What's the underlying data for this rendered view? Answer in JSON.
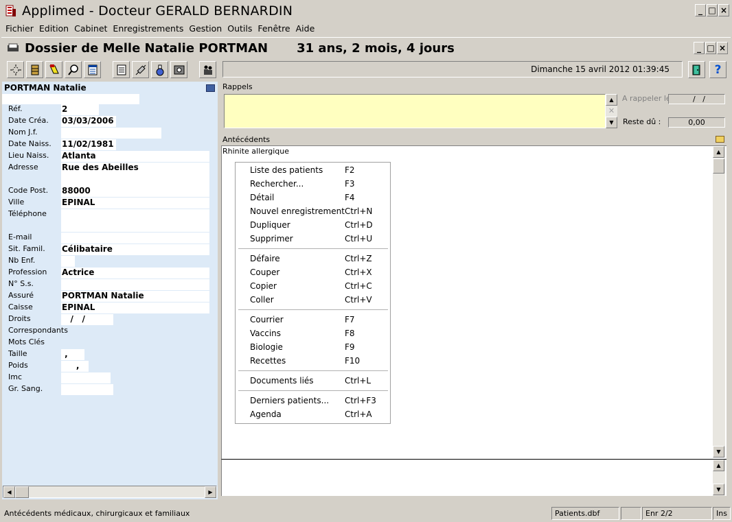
{
  "window": {
    "title": "Applimed - Docteur GERALD BERNARDIN",
    "controls": [
      "_",
      "□",
      "×"
    ]
  },
  "menu": [
    "Fichier",
    "Edition",
    "Cabinet",
    "Enregistrements",
    "Gestion",
    "Outils",
    "Fenêtre",
    "Aide"
  ],
  "document": {
    "title": "Dossier de Melle Natalie PORTMAN",
    "age": "31 ans, 2 mois, 4 jours"
  },
  "toolbar": {
    "datetime": "Dimanche 15 avril 2012   01:39:45",
    "help_label": "?",
    "buttons": [
      "new-icon",
      "file-cabinet-icon",
      "highlighter-icon",
      "magnifier-icon",
      "document-icon",
      "page-icon",
      "syringe-icon",
      "flask-icon",
      "safe-icon",
      "people-icon"
    ]
  },
  "patient": {
    "name": "PORTMAN Natalie",
    "fields": [
      {
        "label": "Réf.",
        "value": "2"
      },
      {
        "label": "Date Créa.",
        "value": "03/03/2006"
      },
      {
        "label": "Nom J.f.",
        "value": ""
      },
      {
        "label": "Date Naiss.",
        "value": "11/02/1981"
      },
      {
        "label": "Lieu Naiss.",
        "value": "Atlanta"
      },
      {
        "label": "Adresse",
        "value": "Rue des Abeilles"
      },
      {
        "label": "Code Post.",
        "value": "88000"
      },
      {
        "label": "Ville",
        "value": "EPINAL"
      },
      {
        "label": "Téléphone",
        "value": ""
      },
      {
        "label": "E-mail",
        "value": ""
      },
      {
        "label": "Sit. Famil.",
        "value": "Célibataire"
      },
      {
        "label": "Nb Enf.",
        "value": ""
      },
      {
        "label": "Profession",
        "value": "Actrice"
      },
      {
        "label": "N° S.s.",
        "value": ""
      },
      {
        "label": "Assuré",
        "value": "PORTMAN Natalie"
      },
      {
        "label": "Caisse",
        "value": "EPINAL"
      },
      {
        "label": "Droits",
        "value": "   /   /"
      },
      {
        "label": "Correspondants",
        "value": ""
      },
      {
        "label": "Mots Clés",
        "value": ""
      },
      {
        "label": "Taille",
        "value": " ,"
      },
      {
        "label": "Poids",
        "value": "     ,"
      },
      {
        "label": "Imc",
        "value": ""
      },
      {
        "label": "Gr. Sang.",
        "value": ""
      }
    ]
  },
  "rappels": {
    "label": "Rappels",
    "a_rappeler_label": "A rappeler le :",
    "a_rappeler_value": "  /   /",
    "reste_du_label": "Reste dû :",
    "reste_du_value": "0,00"
  },
  "antecedents": {
    "label": "Antécédents",
    "text": "Rhinite allergique"
  },
  "context_menu": [
    {
      "label": "Liste des patients",
      "shortcut": "F2"
    },
    {
      "label": "Rechercher...",
      "shortcut": "F3"
    },
    {
      "label": "Détail",
      "shortcut": "F4"
    },
    {
      "label": "Nouvel enregistrement",
      "shortcut": "Ctrl+N"
    },
    {
      "label": "Dupliquer",
      "shortcut": "Ctrl+D"
    },
    {
      "label": "Supprimer",
      "shortcut": "Ctrl+U"
    },
    {
      "label": "Défaire",
      "shortcut": "Ctrl+Z"
    },
    {
      "label": "Couper",
      "shortcut": "Ctrl+X"
    },
    {
      "label": "Copier",
      "shortcut": "Ctrl+C"
    },
    {
      "label": "Coller",
      "shortcut": "Ctrl+V"
    },
    {
      "label": "Courrier",
      "shortcut": "F7"
    },
    {
      "label": "Vaccins",
      "shortcut": "F8"
    },
    {
      "label": "Biologie",
      "shortcut": "F9"
    },
    {
      "label": "Recettes",
      "shortcut": "F10"
    },
    {
      "label": "Documents liés",
      "shortcut": "Ctrl+L"
    },
    {
      "label": "Derniers patients...",
      "shortcut": "Ctrl+F3"
    },
    {
      "label": "Agenda",
      "shortcut": "Ctrl+A"
    }
  ],
  "statusbar": {
    "message": "Antécédents médicaux, chirurgicaux et familiaux",
    "table": "Patients.dbf",
    "blank": "",
    "record": "Enr 2/2",
    "mode": "Ins"
  },
  "colors": {
    "chrome": "#d4d0c8",
    "patient_panel": "#ddeaf7",
    "rappels_bg": "#ffffc0"
  }
}
